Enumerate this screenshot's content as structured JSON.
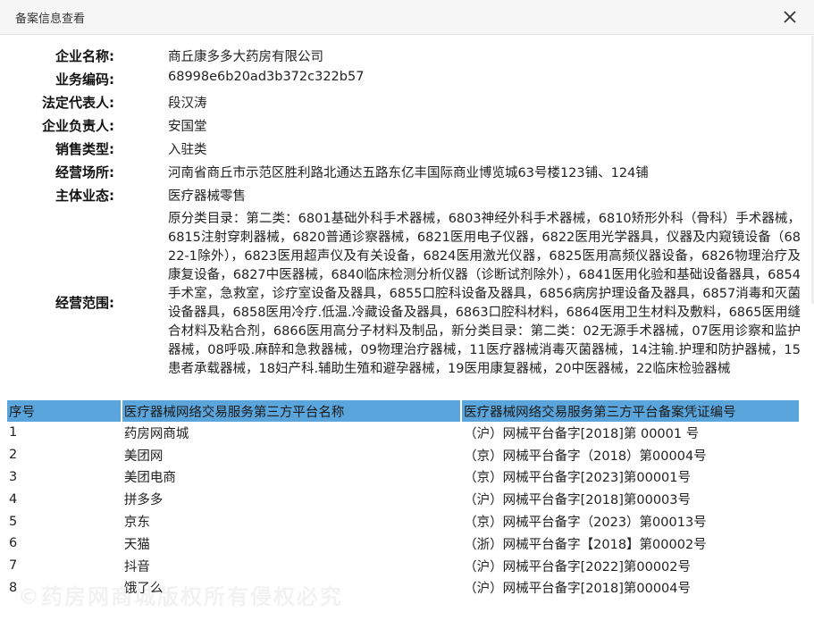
{
  "window": {
    "title": "备案信息查看",
    "close_icon": "close-icon"
  },
  "info": [
    {
      "label": "企业名称:",
      "value": "商丘康多多大药房有限公司"
    },
    {
      "label": "业务编码:",
      "value": "68998e6b20ad3b372c322b57"
    },
    {
      "label": "法定代表人:",
      "value": "段汉涛"
    },
    {
      "label": "企业负责人:",
      "value": "安国堂"
    },
    {
      "label": "销售类型:",
      "value": "入驻类"
    },
    {
      "label": "经营场所:",
      "value": "河南省商丘市示范区胜利路北通达五路东亿丰国际商业博览城63号楼123铺、124铺"
    },
    {
      "label": "主体业态:",
      "value": "医疗器械零售"
    }
  ],
  "scope": {
    "label": "经营范围:",
    "value": "原分类目录：第二类：6801基础外科手术器械，6803神经外科手术器械，6810矫形外科（骨科）手术器械，6815注射穿刺器械，6820普通诊察器械，6821医用电子仪器，6822医用光学器具，仪器及内窥镜设备（6822-1除外），6823医用超声仪及有关设备，6824医用激光仪器，6825医用高频仪器设备，6826物理治疗及康复设备，6827中医器械，6840临床检测分析仪器（诊断试剂除外），6841医用化验和基础设备器具，6854手术室，急救室，诊疗室设备及器具，6855口腔科设备及器具，6856病房护理设备及器具，6857消毒和灭菌设备器具，6858医用冷疗.低温.冷藏设备及器具，6863口腔科材料，6864医用卫生材料及敷料，6865医用缝合材料及粘合剂，6866医用高分子材料及制品，新分类目录：第二类：02无源手术器械，07医用诊察和监护器械，08呼吸.麻醉和急救器械，09物理治疗器械，11医疗器械消毒灭菌器械，14注输.护理和防护器械，15患者承载器械，18妇产科.辅助生殖和避孕器械，19医用康复器械，20中医器械，22临床检验器械"
  },
  "table": {
    "headers": [
      "序号",
      "医疗器械网络交易服务第三方平台名称",
      "医疗器械网络交易服务第三方平台备案凭证编号"
    ],
    "rows": [
      {
        "no": "1",
        "name": "药房网商城",
        "code": "（沪）网械平台备字[2018]第 00001 号"
      },
      {
        "no": "2",
        "name": "美团网",
        "code": "（京）网械平台备字（2018）第00004号"
      },
      {
        "no": "3",
        "name": "美团电商",
        "code": "（京）网械平台备字[2023]第00001号"
      },
      {
        "no": "4",
        "name": "拼多多",
        "code": "（沪）网械平台备字[2018]第00003号"
      },
      {
        "no": "5",
        "name": "京东",
        "code": "（京）网械平台备字（2023）第00013号"
      },
      {
        "no": "6",
        "name": "天猫",
        "code": "（浙）网械平台备字【2018】第00002号"
      },
      {
        "no": "7",
        "name": "抖音",
        "code": "（沪）网械平台备字[2022]第00002号"
      },
      {
        "no": "8",
        "name": "饿了么",
        "code": "（沪）网械平台备字[2018]第00004号"
      }
    ]
  },
  "watermark": "©药房网商城版权所有侵权必究"
}
